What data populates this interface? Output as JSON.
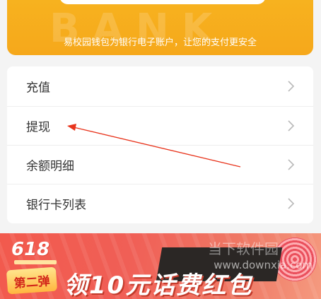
{
  "top_card": {
    "watermark": "BANK",
    "notice": "易校园钱包为银行电子账户，让您的支付更安全"
  },
  "menu": {
    "items": [
      {
        "label": "充值",
        "icon": "chevron-right-icon"
      },
      {
        "label": "提现",
        "icon": "chevron-right-icon"
      },
      {
        "label": "余额明细",
        "icon": "chevron-right-icon"
      },
      {
        "label": "银行卡列表",
        "icon": "chevron-right-icon"
      }
    ]
  },
  "annotation": {
    "color": "#e8341c",
    "target": "提现"
  },
  "banner": {
    "badge": "618",
    "round_tag": "第二弹",
    "headline": "领10元话费红包",
    "watermark_text": "www.downxia.com",
    "watermark_site": "当下软件园"
  },
  "colors": {
    "top_card_orange": "#f6a81b",
    "banner_red": "#f05f56",
    "text_dark": "#333333",
    "chevron": "#b9b9b9"
  }
}
